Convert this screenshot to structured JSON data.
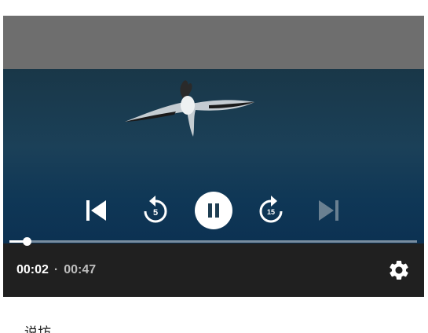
{
  "player": {
    "playback_progress": 0.0426,
    "time_current": "00:02",
    "time_separator": "·",
    "time_total": "00:47",
    "rewind_seconds": "5",
    "forward_seconds": "15",
    "next_enabled": false,
    "state": "playing"
  },
  "icons": {
    "prev": "skip-previous-icon",
    "rewind": "replay-5-icon",
    "pause": "pause-icon",
    "forward": "forward-15-icon",
    "next": "skip-next-icon",
    "settings": "gear-icon"
  },
  "colors": {
    "letterbox": "#6e6e6e",
    "control_bar": "#202020",
    "controls": "#ffffff",
    "disabled": "#8a9aa6"
  },
  "below": {
    "text": "说坊"
  }
}
